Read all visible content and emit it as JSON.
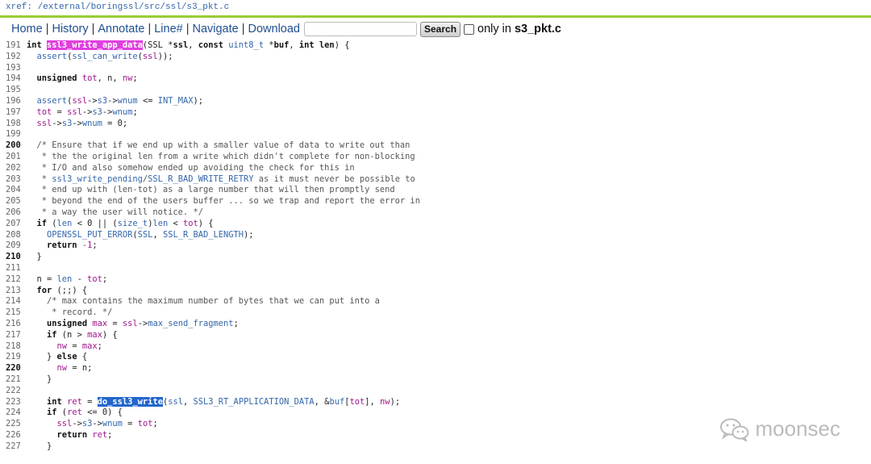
{
  "xref": {
    "path": "xref: /external/boringssl/src/ssl/s3_pkt.c"
  },
  "nav": {
    "home": "Home",
    "history": "History",
    "annotate": "Annotate",
    "line_num": "Line#",
    "navigate": "Navigate",
    "download": "Download",
    "search_value": "",
    "search_label": "Search",
    "only_in_label": "only in",
    "only_in_file": "s3_pkt.c",
    "only_in_checked": false
  },
  "code": {
    "lines": [
      {
        "n": "191",
        "bold": false,
        "segs": [
          [
            "kw",
            "int "
          ],
          [
            "hl-def",
            "ssl3_write_app_data"
          ],
          [
            "",
            "(SSL *"
          ],
          [
            "kw",
            "ssl"
          ],
          [
            "",
            ", "
          ],
          [
            "kw",
            "const "
          ],
          [
            "ty",
            "uint8_t"
          ],
          [
            "",
            " *"
          ],
          [
            "kw",
            "buf"
          ],
          [
            "",
            ", "
          ],
          [
            "kw",
            "int "
          ],
          [
            "kw",
            "len"
          ],
          [
            "",
            ") {"
          ]
        ]
      },
      {
        "n": "192",
        "bold": false,
        "segs": [
          [
            "",
            "  "
          ],
          [
            "fn",
            "assert"
          ],
          [
            "",
            "("
          ],
          [
            "fn",
            "ssl_can_write"
          ],
          [
            "",
            "("
          ],
          [
            "id",
            "ssl"
          ],
          [
            "",
            "));"
          ]
        ]
      },
      {
        "n": "193",
        "bold": false,
        "segs": []
      },
      {
        "n": "194",
        "bold": false,
        "segs": [
          [
            "",
            "  "
          ],
          [
            "kw",
            "unsigned "
          ],
          [
            "id",
            "tot"
          ],
          [
            "",
            ", "
          ],
          [
            "",
            "n"
          ],
          [
            "",
            ", "
          ],
          [
            "id",
            "nw"
          ],
          [
            "",
            ";"
          ]
        ]
      },
      {
        "n": "195",
        "bold": false,
        "segs": []
      },
      {
        "n": "196",
        "bold": false,
        "segs": [
          [
            "",
            "  "
          ],
          [
            "fn",
            "assert"
          ],
          [
            "",
            "("
          ],
          [
            "id",
            "ssl"
          ],
          [
            "",
            "->"
          ],
          [
            "fn",
            "s3"
          ],
          [
            "",
            "->"
          ],
          [
            "fn",
            "wnum"
          ],
          [
            "",
            " <= "
          ],
          [
            "fn",
            "INT_MAX"
          ],
          [
            "",
            ");"
          ]
        ]
      },
      {
        "n": "197",
        "bold": false,
        "segs": [
          [
            "",
            "  "
          ],
          [
            "id",
            "tot"
          ],
          [
            "",
            " = "
          ],
          [
            "id",
            "ssl"
          ],
          [
            "",
            "->"
          ],
          [
            "fn",
            "s3"
          ],
          [
            "",
            "->"
          ],
          [
            "fn",
            "wnum"
          ],
          [
            "",
            ";"
          ]
        ]
      },
      {
        "n": "198",
        "bold": false,
        "segs": [
          [
            "",
            "  "
          ],
          [
            "id",
            "ssl"
          ],
          [
            "",
            "->"
          ],
          [
            "fn",
            "s3"
          ],
          [
            "",
            "->"
          ],
          [
            "fn",
            "wnum"
          ],
          [
            "",
            " = 0;"
          ]
        ]
      },
      {
        "n": "199",
        "bold": false,
        "segs": []
      },
      {
        "n": "200",
        "bold": true,
        "segs": [
          [
            "",
            "  "
          ],
          [
            "cmt",
            "/* Ensure that if we end up with a smaller value of data to write out than"
          ]
        ]
      },
      {
        "n": "201",
        "bold": false,
        "segs": [
          [
            "",
            "  "
          ],
          [
            "cmt",
            " * the the original len from a write which didn't complete for non-blocking"
          ]
        ]
      },
      {
        "n": "202",
        "bold": false,
        "segs": [
          [
            "",
            "  "
          ],
          [
            "cmt",
            " * I/O and also somehow ended up avoiding the check for this in"
          ]
        ]
      },
      {
        "n": "203",
        "bold": false,
        "segs": [
          [
            "",
            "  "
          ],
          [
            "cmt",
            " * "
          ],
          [
            "fn",
            "ssl3_write_pending"
          ],
          [
            "cmt",
            "/"
          ],
          [
            "fn",
            "SSL_R_BAD_WRITE_RETRY"
          ],
          [
            "cmt",
            " as it must never be possible to"
          ]
        ]
      },
      {
        "n": "204",
        "bold": false,
        "segs": [
          [
            "",
            "  "
          ],
          [
            "cmt",
            " * end up with (len-tot) as a large number that will then promptly send"
          ]
        ]
      },
      {
        "n": "205",
        "bold": false,
        "segs": [
          [
            "",
            "  "
          ],
          [
            "cmt",
            " * beyond the end of the users buffer ... so we trap and report the error in"
          ]
        ]
      },
      {
        "n": "206",
        "bold": false,
        "segs": [
          [
            "",
            "  "
          ],
          [
            "cmt",
            " * a way the user will notice. */"
          ]
        ]
      },
      {
        "n": "207",
        "bold": false,
        "segs": [
          [
            "",
            "  "
          ],
          [
            "kw",
            "if"
          ],
          [
            "",
            " ("
          ],
          [
            "fn",
            "len"
          ],
          [
            "",
            " < 0 || ("
          ],
          [
            "fn",
            "size_t"
          ],
          [
            "",
            ")"
          ],
          [
            "fn",
            "len"
          ],
          [
            "",
            " < "
          ],
          [
            "id",
            "tot"
          ],
          [
            "",
            ") {"
          ]
        ]
      },
      {
        "n": "208",
        "bold": false,
        "segs": [
          [
            "",
            "    "
          ],
          [
            "fn",
            "OPENSSL_PUT_ERROR"
          ],
          [
            "",
            "("
          ],
          [
            "fn",
            "SSL"
          ],
          [
            "",
            ", "
          ],
          [
            "fn",
            "SSL_R_BAD_LENGTH"
          ],
          [
            "",
            ");"
          ]
        ]
      },
      {
        "n": "209",
        "bold": false,
        "segs": [
          [
            "",
            "    "
          ],
          [
            "kw",
            "return"
          ],
          [
            "",
            " "
          ],
          [
            "num",
            "-1"
          ],
          [
            "",
            ";"
          ]
        ]
      },
      {
        "n": "210",
        "bold": true,
        "segs": [
          [
            "",
            "  }"
          ]
        ]
      },
      {
        "n": "211",
        "bold": false,
        "segs": []
      },
      {
        "n": "212",
        "bold": false,
        "segs": [
          [
            "",
            "  n = "
          ],
          [
            "fn",
            "len"
          ],
          [
            "",
            " - "
          ],
          [
            "id",
            "tot"
          ],
          [
            "",
            ";"
          ]
        ]
      },
      {
        "n": "213",
        "bold": false,
        "segs": [
          [
            "",
            "  "
          ],
          [
            "kw",
            "for"
          ],
          [
            "",
            " (;;) {"
          ]
        ]
      },
      {
        "n": "214",
        "bold": false,
        "segs": [
          [
            "",
            "    "
          ],
          [
            "cmt",
            "/* max contains the maximum number of bytes that we can put into a"
          ]
        ]
      },
      {
        "n": "215",
        "bold": false,
        "segs": [
          [
            "",
            "    "
          ],
          [
            "cmt",
            " * record. */"
          ]
        ]
      },
      {
        "n": "216",
        "bold": false,
        "segs": [
          [
            "",
            "    "
          ],
          [
            "kw",
            "unsigned "
          ],
          [
            "id",
            "max"
          ],
          [
            "",
            " = "
          ],
          [
            "id",
            "ssl"
          ],
          [
            "",
            "->"
          ],
          [
            "fn",
            "max_send_fragment"
          ],
          [
            "",
            ";"
          ]
        ]
      },
      {
        "n": "217",
        "bold": false,
        "segs": [
          [
            "",
            "    "
          ],
          [
            "kw",
            "if"
          ],
          [
            "",
            " (n > "
          ],
          [
            "id",
            "max"
          ],
          [
            "",
            ") {"
          ]
        ]
      },
      {
        "n": "218",
        "bold": false,
        "segs": [
          [
            "",
            "      "
          ],
          [
            "id",
            "nw"
          ],
          [
            "",
            " = "
          ],
          [
            "id",
            "max"
          ],
          [
            "",
            ";"
          ]
        ]
      },
      {
        "n": "219",
        "bold": false,
        "segs": [
          [
            "",
            "    } "
          ],
          [
            "kw",
            "else"
          ],
          [
            "",
            " {"
          ]
        ]
      },
      {
        "n": "220",
        "bold": true,
        "segs": [
          [
            "",
            "      "
          ],
          [
            "id",
            "nw"
          ],
          [
            "",
            " = n;"
          ]
        ]
      },
      {
        "n": "221",
        "bold": false,
        "segs": [
          [
            "",
            "    }"
          ]
        ]
      },
      {
        "n": "222",
        "bold": false,
        "segs": []
      },
      {
        "n": "223",
        "bold": false,
        "segs": [
          [
            "",
            "    "
          ],
          [
            "kw",
            "int "
          ],
          [
            "id",
            "ret"
          ],
          [
            "",
            " = "
          ],
          [
            "hl-ref",
            "do_ssl3_write"
          ],
          [
            "",
            "("
          ],
          [
            "fn",
            "ssl"
          ],
          [
            "",
            ", "
          ],
          [
            "fn",
            "SSL3_RT_APPLICATION_DATA"
          ],
          [
            "",
            ", &"
          ],
          [
            "fn",
            "buf"
          ],
          [
            "",
            "["
          ],
          [
            "id",
            "tot"
          ],
          [
            "",
            "], "
          ],
          [
            "id",
            "nw"
          ],
          [
            "",
            ");"
          ]
        ]
      },
      {
        "n": "224",
        "bold": false,
        "segs": [
          [
            "",
            "    "
          ],
          [
            "kw",
            "if"
          ],
          [
            "",
            " ("
          ],
          [
            "id",
            "ret"
          ],
          [
            "",
            " <= 0) {"
          ]
        ]
      },
      {
        "n": "225",
        "bold": false,
        "segs": [
          [
            "",
            "      "
          ],
          [
            "id",
            "ssl"
          ],
          [
            "",
            "->"
          ],
          [
            "fn",
            "s3"
          ],
          [
            "",
            "->"
          ],
          [
            "fn",
            "wnum"
          ],
          [
            "",
            " = "
          ],
          [
            "id",
            "tot"
          ],
          [
            "",
            ";"
          ]
        ]
      },
      {
        "n": "226",
        "bold": false,
        "segs": [
          [
            "",
            "      "
          ],
          [
            "kw",
            "return"
          ],
          [
            "",
            " "
          ],
          [
            "id",
            "ret"
          ],
          [
            "",
            ";"
          ]
        ]
      },
      {
        "n": "227",
        "bold": false,
        "segs": [
          [
            "",
            "    }"
          ]
        ]
      }
    ]
  },
  "watermark": {
    "text": "moonsec",
    "icon": "wechat-icon"
  }
}
